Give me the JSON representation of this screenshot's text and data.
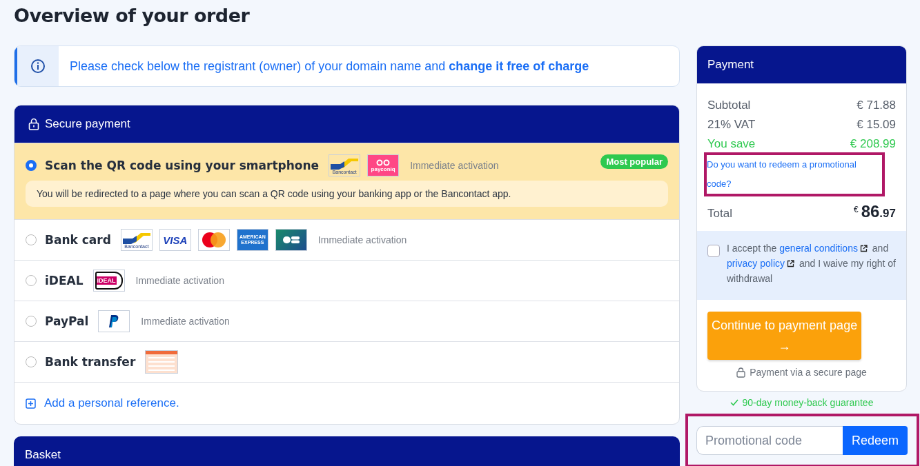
{
  "page": {
    "title": "Overview of your order"
  },
  "notice": {
    "text": "Please check below the registrant (owner) of your domain name and **change it free of charge**"
  },
  "secure_payment": {
    "title": "Secure payment",
    "methods": [
      {
        "label": "Scan the QR code using your smartphone",
        "selected": true,
        "logos": [
          {
            "kind": "bancontact",
            "text": "Bancontact"
          },
          {
            "kind": "payconiq",
            "text": "payconiq"
          }
        ],
        "note": "Immediate activation",
        "badge": "Most popular",
        "description": "You will be redirected to a page where you can scan a QR code using your banking app or the Bancontact app."
      },
      {
        "label": "Bank card",
        "selected": false,
        "logos": [
          {
            "kind": "bancontact",
            "text": "Bancontact"
          },
          {
            "kind": "visa",
            "text": "VISA"
          },
          {
            "kind": "mastercard"
          },
          {
            "kind": "amex",
            "text": "AMERICAN EXPRESS"
          },
          {
            "kind": "cb"
          }
        ],
        "note": "Immediate activation"
      },
      {
        "label": "iDEAL",
        "selected": false,
        "logos": [
          {
            "kind": "ideal",
            "text": "iDEAL"
          }
        ],
        "note": "Immediate activation"
      },
      {
        "label": "PayPal",
        "selected": false,
        "logos": [
          {
            "kind": "paypal"
          }
        ],
        "note": "Immediate activation"
      },
      {
        "label": "Bank transfer",
        "selected": false,
        "logos": [
          {
            "kind": "transfer"
          }
        ]
      }
    ],
    "add_reference": "Add a personal reference."
  },
  "basket": {
    "title": "Basket"
  },
  "payment": {
    "title": "Payment",
    "lines": [
      {
        "label": "Subtotal",
        "value": "€ 71.88",
        "kind": "normal"
      },
      {
        "label": "21% VAT",
        "value": "€ 15.09",
        "kind": "normal"
      },
      {
        "label": "You save",
        "value": "€ 208.99",
        "kind": "saving"
      }
    ],
    "promo_link": {
      "text": "Do you want to redeem a promotional code?",
      "highlighted": true
    },
    "total": {
      "label": "Total",
      "currency": "€",
      "whole": "86",
      "cents": ".97"
    },
    "terms": {
      "checked": false,
      "segments": [
        {
          "kind": "text",
          "text": "I accept the"
        },
        {
          "kind": "link",
          "text": "general conditions"
        },
        {
          "kind": "text",
          "text": "and"
        },
        {
          "kind": "link",
          "text": "privacy policy"
        },
        {
          "kind": "text",
          "text": "and I waive my right of withdrawal"
        }
      ]
    },
    "button": {
      "label": "Continue to payment page",
      "arrow": "→"
    },
    "secure_note": "Payment via a secure page"
  },
  "guarantee": "90-day money-back guarantee",
  "promo_form": {
    "placeholder": "Promotional code",
    "button": "Redeem",
    "highlighted": true
  }
}
